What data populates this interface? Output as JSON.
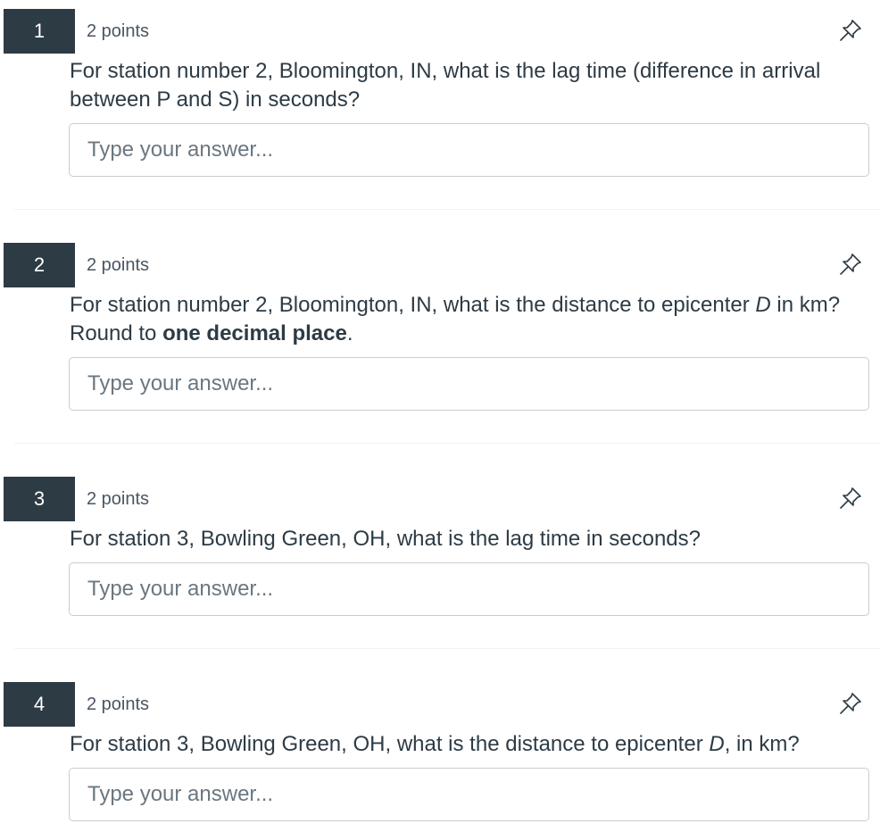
{
  "questions": [
    {
      "number": "1",
      "points": "2 points",
      "text_parts": [
        {
          "t": "For station number 2, Bloomington, IN, what is the lag time (difference in arrival between P and S) in seconds?",
          "s": "normal"
        }
      ],
      "placeholder": "Type your answer..."
    },
    {
      "number": "2",
      "points": "2 points",
      "text_parts": [
        {
          "t": "For station number 2, Bloomington, IN, what is the distance to epicenter ",
          "s": "normal"
        },
        {
          "t": "D",
          "s": "italic"
        },
        {
          "t": " in km? Round to ",
          "s": "normal"
        },
        {
          "t": "one decimal place",
          "s": "bold"
        },
        {
          "t": ".",
          "s": "normal"
        }
      ],
      "placeholder": "Type your answer..."
    },
    {
      "number": "3",
      "points": "2 points",
      "text_parts": [
        {
          "t": "For station 3, Bowling Green, OH, what is the lag time in seconds?",
          "s": "normal"
        }
      ],
      "placeholder": "Type your answer..."
    },
    {
      "number": "4",
      "points": "2 points",
      "text_parts": [
        {
          "t": "For station 3, Bowling Green, OH, what is the distance to epicenter ",
          "s": "normal"
        },
        {
          "t": "D",
          "s": "italic"
        },
        {
          "t": ", in km?",
          "s": "normal"
        }
      ],
      "placeholder": "Type your answer..."
    }
  ],
  "icons": {
    "pin": "pin-icon"
  },
  "colors": {
    "number_badge_bg": "#2d3b45",
    "text": "#2d3b45",
    "input_border": "#c7cdd1"
  }
}
